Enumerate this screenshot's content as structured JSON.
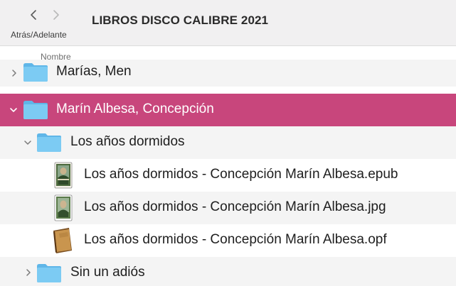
{
  "toolbar": {
    "back_label": "Atrás/Adelante",
    "title": "LIBROS DISCO CALIBRE 2021",
    "back_icon": "chevron-left-icon",
    "forward_icon": "chevron-right-icon"
  },
  "columns": {
    "name": "Nombre"
  },
  "colors": {
    "selection": "#c8467c",
    "folder": "#6cc0ee"
  },
  "rows": [
    {
      "label": "Marías, Men",
      "type": "folder",
      "expanded": false,
      "selected": false
    },
    {
      "label": "Marín Albesa, Concepción",
      "type": "folder",
      "expanded": true,
      "selected": true
    },
    {
      "label": "Los años dormidos",
      "type": "folder",
      "expanded": true,
      "selected": false
    },
    {
      "label": "Los años dormidos - Concepción Marín Albesa.epub",
      "type": "epub-file",
      "selected": false
    },
    {
      "label": "Los años dormidos - Concepción Marín Albesa.jpg",
      "type": "image-file",
      "selected": false
    },
    {
      "label": "Los años dormidos - Concepción Marín Albesa.opf",
      "type": "opf-file",
      "selected": false
    },
    {
      "label": "Sin un adiós",
      "type": "folder",
      "expanded": false,
      "selected": false
    }
  ]
}
